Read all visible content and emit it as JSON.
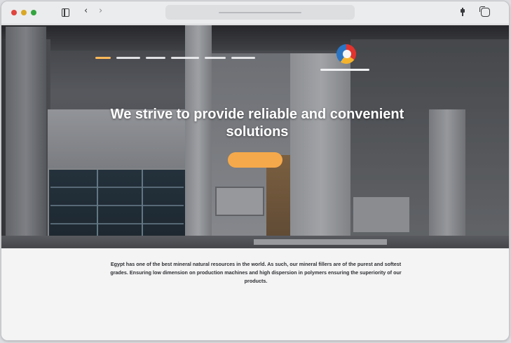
{
  "browser": {
    "address_text": ""
  },
  "site": {
    "nav_links": [
      "",
      "",
      "",
      "",
      "",
      ""
    ],
    "nav_cta_label": "",
    "hero": {
      "title": "We strive to provide reliable and convenient solutions",
      "button_label": ""
    },
    "intro_text": "Egypt has one of the best mineral natural resources in the world. As such, our mineral fillers are of the purest and softest grades. Ensuring low dimension on production machines and high dispersion in polymers ensuring the superiority of our products."
  },
  "colors": {
    "accent": "#f6a94a",
    "logo_red": "#e2332e",
    "logo_yellow": "#f4b32c",
    "logo_blue": "#2a74c4"
  }
}
